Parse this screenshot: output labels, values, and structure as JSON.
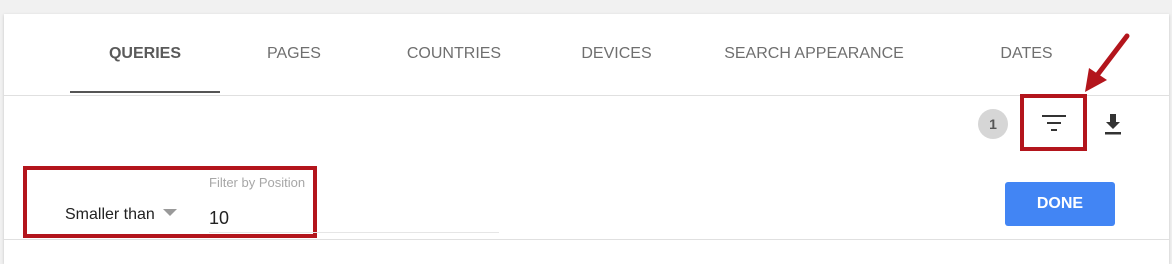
{
  "tabs": [
    {
      "label": "QUERIES",
      "active": true
    },
    {
      "label": "PAGES",
      "active": false
    },
    {
      "label": "COUNTRIES",
      "active": false
    },
    {
      "label": "DEVICES",
      "active": false
    },
    {
      "label": "SEARCH APPEARANCE",
      "active": false
    },
    {
      "label": "DATES",
      "active": false
    }
  ],
  "toolbar": {
    "filter_count": "1",
    "filter_icon": "filter-list-icon",
    "download_icon": "download-icon"
  },
  "filter": {
    "label": "Filter by Position",
    "operator": "Smaller than",
    "value": "10",
    "done_label": "DONE"
  },
  "colors": {
    "accent": "#4285f4",
    "highlight": "#b3151c",
    "active_tab": "#555555"
  }
}
